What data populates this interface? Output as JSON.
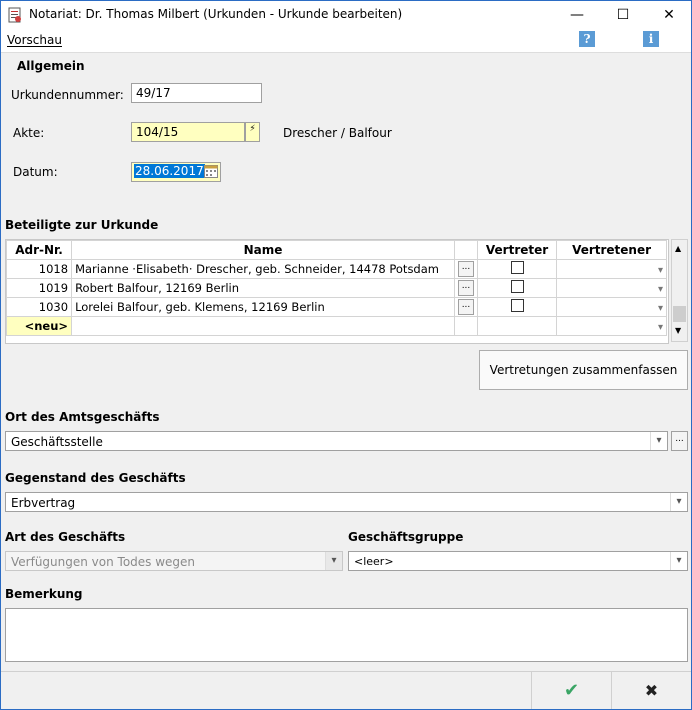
{
  "window": {
    "title": "Notariat: Dr. Thomas Milbert (Urkunden - Urkunde bearbeiten)",
    "controls": {
      "minimize": "—",
      "maximize": "☐",
      "close": "✕"
    }
  },
  "menu": {
    "preview": "Vorschau"
  },
  "general": {
    "heading": "Allgemein",
    "deed_number_label": "Urkundennummer:",
    "deed_number_value": "49/17",
    "file_label": "Akte:",
    "file_value": "104/15",
    "file_name": "Drescher / Balfour",
    "date_label": "Datum:",
    "date_value": "28.06.2017"
  },
  "participants": {
    "heading": "Beteiligte zur Urkunde",
    "columns": [
      "Adr-Nr.",
      "Name",
      "Vertreter",
      "Vertretener"
    ],
    "rows": [
      {
        "adr": "1018",
        "name": "Marianne ·Elisabeth· Drescher, geb. Schneider, 14478 Potsdam"
      },
      {
        "adr": "1019",
        "name": "Robert Balfour, 12169 Berlin"
      },
      {
        "adr": "1030",
        "name": "Lorelei Balfour, geb. Klemens, 12169 Berlin"
      }
    ],
    "new_row": "<neu>",
    "merge_button": "Vertretungen zusammenfassen"
  },
  "location": {
    "heading": "Ort des Amtsgeschäfts",
    "value": "Geschäftsstelle"
  },
  "subject": {
    "heading": "Gegenstand des Geschäfts",
    "value": "Erbvertrag"
  },
  "kind": {
    "heading": "Art des Geschäfts",
    "value": "Verfügungen von Todes wegen"
  },
  "group": {
    "heading": "Geschäftsgruppe",
    "value": "<leer>"
  },
  "remark": {
    "heading": "Bemerkung",
    "value": ""
  },
  "footer": {
    "ok_icon": "✔",
    "cancel_icon": "✖"
  }
}
